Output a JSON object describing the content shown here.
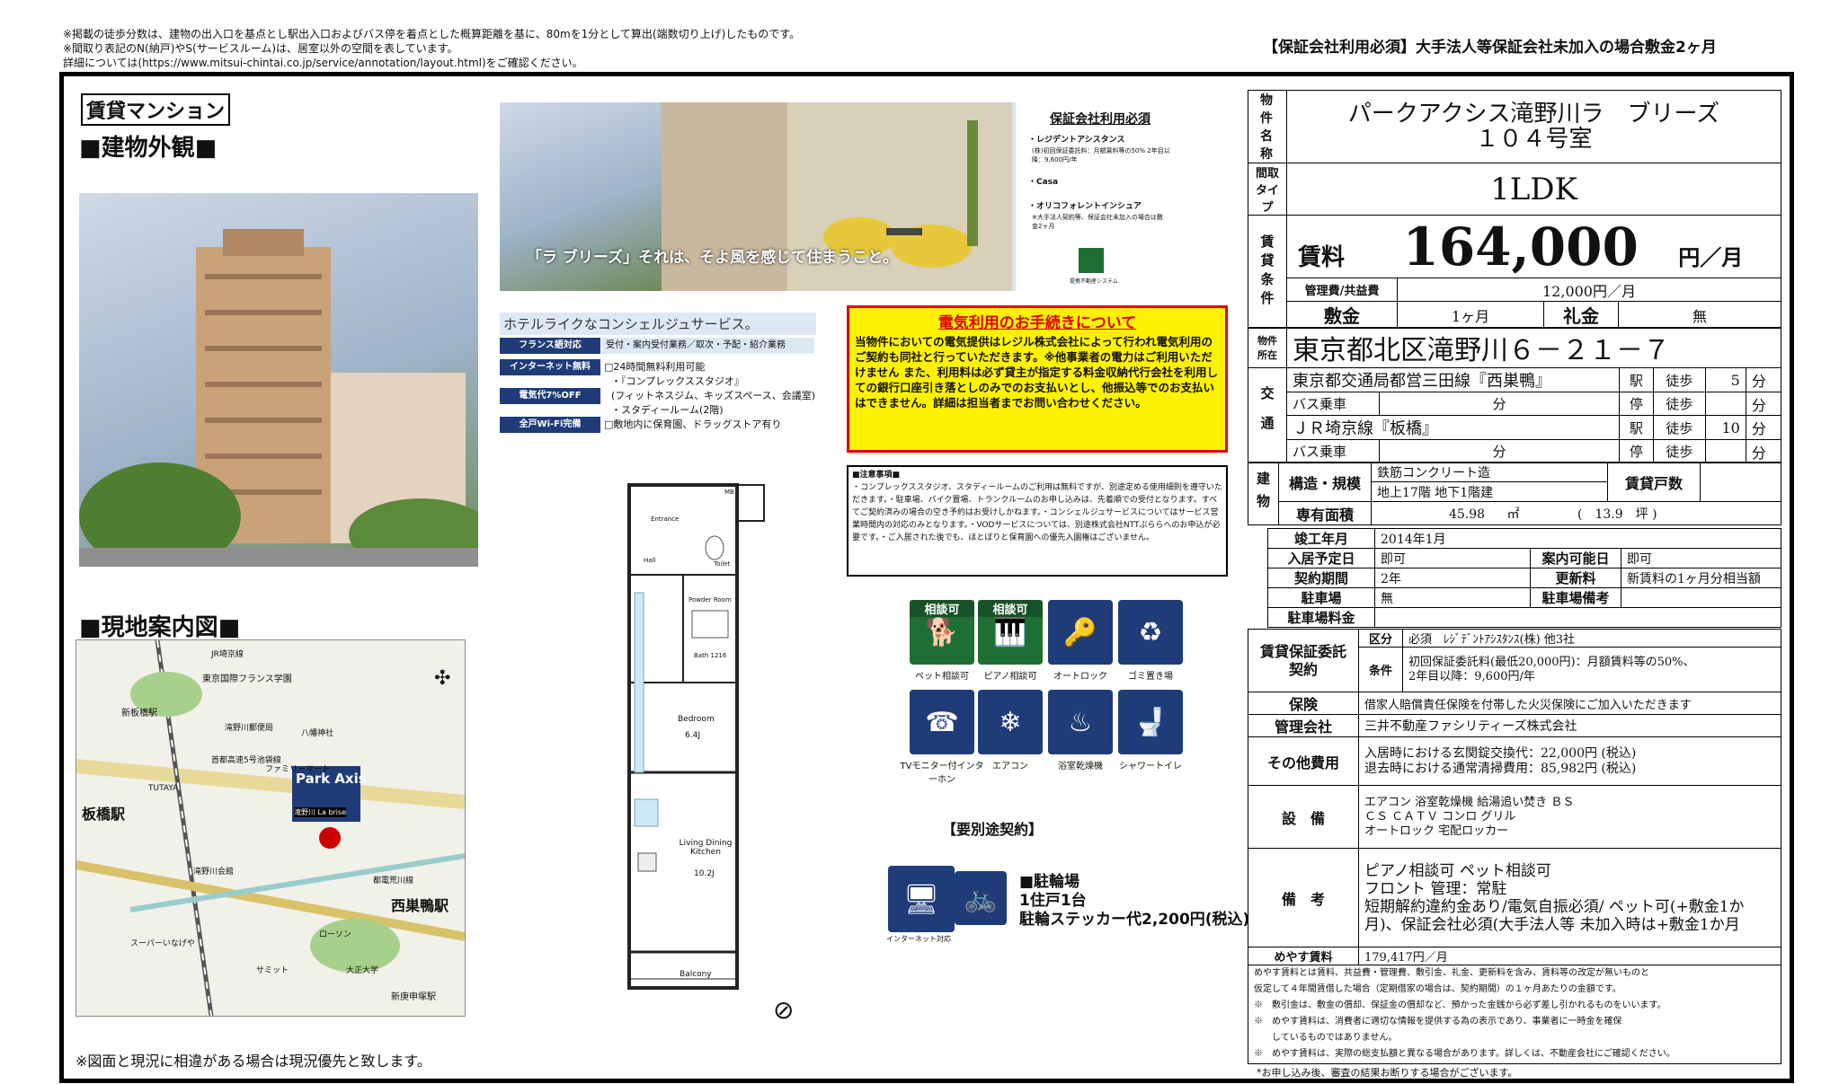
{
  "top_notes": {
    "line1": "※掲載の徒歩分数は、建物の出入口を基点とし駅出入口およびバス停を着点とした概算距離を基に、80mを1分として算出(端数切り上げ)したものです。",
    "line2": "※間取り表記のN(納戸)やS(サービスルーム)は、居室以外の空間を表しています。",
    "line3": "詳細については(https://www.mitsui-chintai.co.jp/service/annotation/layout.html)をご確認ください。",
    "right": "【保証会社利用必須】大手法人等保証会社未加入の場合敷金2ヶ月"
  },
  "left": {
    "type_badge": "賃貸マンション",
    "exterior_heading": "■建物外観■",
    "map_heading": "■現地案内図■",
    "map": {
      "logo": "Park Axis",
      "logo_sub": "滝野川 La brise",
      "stations": [
        "板橋駅",
        "西巣鴨駅",
        "新板橋駅",
        "新庚申塚駅"
      ],
      "lines": [
        "JR埼京線",
        "首都高速5号池袋線",
        "都電荒川線"
      ],
      "places": [
        "東京国際フランス学園",
        "滝野川郵便局",
        "TUTAYA",
        "八幡神社",
        "滝野川会館",
        "ファミリーマート",
        "ローソン",
        "サミット",
        "スーパーいなげや",
        "大正大学"
      ]
    },
    "footnote": "※図面と現況に相違がある場合は現況優先と致します。"
  },
  "banner": {
    "caption": "「ラ ブリーズ」それは、そよ風を感じて住まうこと。",
    "guarantee_title": "保証会社利用必須",
    "g1": "・レジデントアシスタンス",
    "g1_detail": "(株)初回保証委託料：月額賃料等の50% 2年目以降：9,600円/年",
    "g2": "・Casa",
    "g3": "・オリコフォレントインシュア",
    "g3_detail": "※大手法人契約等、保証会社未加入の場合は敷金2ヶ月",
    "logo_caption": "提携不動産システム"
  },
  "concierge": {
    "title": "ホテルライクなコンシェルジュサービス。",
    "rows": [
      {
        "tag": "フランス語対応",
        "text": "受付・案内受付業務／取次・予配・紹介業務"
      },
      {
        "tag": "インターネット無料",
        "text": "□24時間無料利用可能"
      },
      {
        "tag": "",
        "text": "・『コンプレックススタジオ』"
      },
      {
        "tag": "電気代7%OFF",
        "text": "(フィットネスジム、キッズスペース、会議室)"
      },
      {
        "tag": "",
        "text": "・スタディールーム(2階)"
      },
      {
        "tag": "全戸Wi-Fi完備",
        "text": "□敷地内に保育園、ドラッグストア有り"
      }
    ]
  },
  "electric": {
    "title": "電気利用のお手続きについて",
    "body": "当物件においての電気提供はレジル株式会社によって行われ電気利用のご契約も同社と行っていただきます。※他事業者の電力はご利用いただけません また、利用料は必ず貸主が指定する料金収納代行会社を利用しての銀行口座引き落としのみでのお支払いとし、他振込等でのお支払いはできません。詳細は担当者までお問い合わせください。"
  },
  "caution": {
    "title": "■注意事項■",
    "body": "・コンプレックススタジオ、スタディールームのご利用は無料ですが、別途定める使用細則を遵守いただきます。・駐車場、バイク置場、トランクルームのお申し込みは、先着順での受付となります。すべてご契約済みの場合の空き予約はお受けしかねます。・コンシェルジュサービスについてはサービス営業時間内の対応のみとなります。・VODサービスについては、別途株式会社NTTぷららへのお申込が必要です。・ご入居された後でも、ほとぼりと保育園への優先入園権はございません。"
  },
  "floorplan": {
    "rooms": [
      "MB",
      "Entrance",
      "Hall",
      "Toilet",
      "Powder Room",
      "Bath 1216",
      "Bedroom",
      "6.4J",
      "Living Dining Kitchen",
      "10.2J",
      "Balcony"
    ]
  },
  "amenities": [
    {
      "icon": "dog-icon",
      "label": "ペット相談可",
      "badge": "相談可",
      "green": true
    },
    {
      "icon": "piano-icon",
      "label": "ピアノ相談可",
      "badge": "相談可",
      "green": true
    },
    {
      "icon": "autolock-icon",
      "label": "オートロック",
      "badge": "",
      "green": false
    },
    {
      "icon": "garbage-icon",
      "label": "ゴミ置き場",
      "badge": "",
      "green": false
    },
    {
      "icon": "intercom-icon",
      "label": "TVモニター付インターホン",
      "badge": "",
      "green": false
    },
    {
      "icon": "aircon-icon",
      "label": "エアコン",
      "badge": "",
      "green": false
    },
    {
      "icon": "bathdryer-icon",
      "label": "浴室乾燥機",
      "badge": "",
      "green": false
    },
    {
      "icon": "shower-toilet-icon",
      "label": "シャワートイレ",
      "badge": "",
      "green": false
    }
  ],
  "separate_contract": "【要別途契約】",
  "internet_label": "インターネット対応",
  "bicycle": {
    "title": "■駐輪場",
    "line1": "1住戸1台",
    "line2": "駐輪ステッカー代2,200円(税込)"
  },
  "property": {
    "name_label": "物件名称",
    "name_line1": "パークアクシス滝野川ラ　ブリーズ",
    "name_line2": "１０４号室",
    "layout_label": "間取タイプ",
    "layout": "1LDK",
    "rent_group_label": "賃貸条件",
    "rent_label": "賃料",
    "rent": "164,000",
    "rent_unit": "円／月",
    "mgmt_label": "管理費/共益費",
    "mgmt": "12,000円／月",
    "deposit_label": "敷金",
    "deposit": "1ヶ月",
    "key_label": "礼金",
    "key": "無",
    "address_label": "物件所在",
    "address": "東京都北区滝野川６－２１－７",
    "transit_label": "交通",
    "t1_line": "東京都交通局都営三田線『西巣鴨』",
    "t1_station": "駅",
    "t1_walk": "徒歩",
    "t1_min": "5",
    "t1_unit": "分",
    "bus1_label": "バス乗車",
    "bus1_unit": "分",
    "bus1_stop": "停",
    "bus1_walk": "徒歩",
    "bus1_unit2": "分",
    "t2_line": "ＪＲ埼京線『板橋』",
    "t2_station": "駅",
    "t2_walk": "徒歩",
    "t2_min": "10",
    "t2_unit": "分",
    "bus2_label": "バス乗車",
    "bus2_unit": "分",
    "bus2_stop": "停",
    "bus2_walk": "徒歩",
    "bus2_unit2": "分",
    "building_label": "建物",
    "structure_label": "構造・規模",
    "structure1": "鉄筋コンクリート造",
    "structure2": "地上17階 地下1階建",
    "units_label": "賃貸戸数",
    "area_label": "専有面積",
    "area": "45.98",
    "area_unit": "㎡",
    "area_tsubo": "(　13.9　坪 )",
    "built_label": "竣工年月",
    "built": "2014年1月",
    "move_label": "入居予定日",
    "move": "即可",
    "viewing_label": "案内可能日",
    "viewing": "即可",
    "term_label": "契約期間",
    "term": "2年",
    "renewal_label": "更新料",
    "renewal": "新賃料の1ヶ月分相当額",
    "parking_label": "駐車場",
    "parking": "無",
    "parking_note_label": "駐車場備考",
    "parking_fee_label": "駐車場料金",
    "guar_label": "賃貸保証委託契約",
    "guar_kubun_label": "区分",
    "guar_kubun": "必須　ﾚｼﾞﾃﾞﾝﾄｱｼｽﾀﾝｽ(株) 他3社",
    "guar_cond_label": "条件",
    "guar_cond1": "初回保証委託料(最低20,000円)：月額賃料等の50%、",
    "guar_cond2": "2年目以降：9,600円/年",
    "insurance_label": "保険",
    "insurance": "借家人賠償責任保険を付帯した火災保険にご加入いただきます",
    "mgmt_co_label": "管理会社",
    "mgmt_co": "三井不動産ファシリティーズ株式会社",
    "other_label": "その他費用",
    "other1": "入居時における玄関錠交換代：22,000円 (税込)",
    "other2": "退去時における通常清掃費用：85,982円 (税込)",
    "equip_label": "設　備",
    "equip1": "エアコン 浴室乾燥機 給湯追い焚き ＢＳ",
    "equip2": "ＣＳ ＣＡＴＶ コンロ グリル",
    "equip3": "オートロック 宅配ロッカー",
    "remarks_label": "備　考",
    "remarks1": "ピアノ相談可 ペット相談可",
    "remarks2": "フロント 管理：常駐",
    "remarks3": "短期解約違約金あり/電気自振必須/ ペット可(+敷金1か月)、保証会社必須(大手法人等 未加入時は+敷金1か月",
    "meyasu_label": "めやす賃料",
    "meyasu": "179,417円／月",
    "meyasu_note1": "めやす賃料とは賃料、共益費・管理費、敷引金、礼金、更新料を含み、賃料等の改定が無いものと",
    "meyasu_note2": "仮定して４年間賃借した場合（定期借家の場合は、契約期間）の１ヶ月あたりの金額です。",
    "meyasu_note3": "※　敷引金は、敷金の償却、保証金の償却など、預かった金銭から必ず差し引かれるものをいいます。",
    "meyasu_note4": "※　めやす賃料は、消費者に適切な情報を提供する為の表示であり、事業者に一時金を確保",
    "meyasu_note5": "　　しているものではありません。",
    "meyasu_note6": "※　めやす賃料は、実際の総支払額と異なる場合があります。詳しくは、不動産会社にご確認ください。",
    "bottom_note": "*お申し込み後、審査の結果お断りする場合がございます。"
  }
}
